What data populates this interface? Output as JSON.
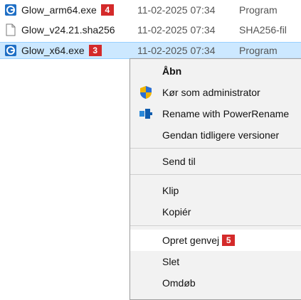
{
  "files": [
    {
      "name": "Glow_arm64.exe",
      "badge": "4",
      "date": "11-02-2025 07:34",
      "type": "Program",
      "icon": "glow-app-icon"
    },
    {
      "name": "Glow_v24.21.sha256",
      "badge": "",
      "date": "11-02-2025 07:34",
      "type": "SHA256-fil",
      "icon": "blank-file-icon"
    },
    {
      "name": "Glow_x64.exe",
      "badge": "3",
      "date": "11-02-2025 07:34",
      "type": "Program",
      "icon": "glow-app-icon"
    }
  ],
  "menu": {
    "open": "Åbn",
    "run_as_admin": "Kør som administrator",
    "rename": "Rename with PowerRename",
    "restore": "Gendan tidligere versioner",
    "send_to": "Send til",
    "cut": "Klip",
    "copy": "Kopiér",
    "create_shortcut": "Opret genvej",
    "create_shortcut_badge": "5",
    "delete": "Slet",
    "rename_item": "Omdøb"
  },
  "colors": {
    "selection": "#cce8ff",
    "badge": "#d42a2a",
    "menu_bg": "#f2f2f2",
    "hover": "#ffffff"
  }
}
